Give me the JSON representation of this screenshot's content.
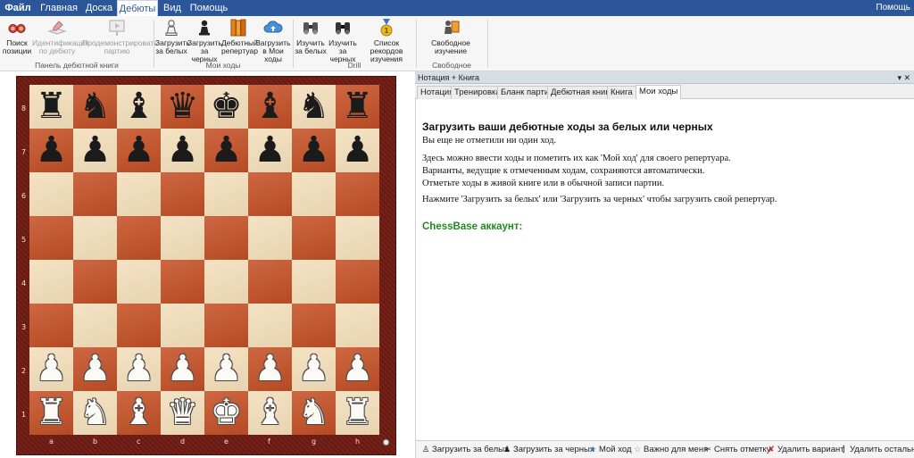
{
  "menu": {
    "tabs": [
      {
        "label": "Файл"
      },
      {
        "label": "Главная"
      },
      {
        "label": "Доска"
      },
      {
        "label": "Дебюты"
      },
      {
        "label": "Вид"
      },
      {
        "label": "Помощь"
      }
    ],
    "active": "Дебюты",
    "right_help": "Помощь"
  },
  "ribbon": {
    "buttons": [
      {
        "label": "Поиск позиции",
        "icon": "glasses-icon",
        "enabled": true
      },
      {
        "label": "Идентификация по дебюту",
        "icon": "book-pen-icon",
        "enabled": false
      },
      {
        "label": "Продемонстрировать партию",
        "icon": "presentation-icon",
        "enabled": false
      },
      {
        "label": "Загрузить за белых",
        "icon": "white-pawn-icon",
        "enabled": true
      },
      {
        "label": "Загрузить за черных",
        "icon": "black-pawn-icon",
        "enabled": true
      },
      {
        "label": "Дебютный репертуар",
        "icon": "books-icon",
        "enabled": true
      },
      {
        "label": "Загрузить в Мои ходы",
        "icon": "cloud-upload-icon",
        "enabled": true
      },
      {
        "label": "Изучить за белых",
        "icon": "binoculars-icon",
        "enabled": true
      },
      {
        "label": "Изучить за черных",
        "icon": "binoculars-icon",
        "enabled": true
      },
      {
        "label": "Список рекордов изучения",
        "icon": "medal-icon",
        "enabled": true
      },
      {
        "label": "Свободное изучение",
        "icon": "free-study-icon",
        "enabled": true
      }
    ],
    "groups": [
      {
        "label": "Панель дебютной книги"
      },
      {
        "label": "Мои ходы"
      },
      {
        "label": "Drill"
      },
      {
        "label": "Свободное изучение"
      }
    ]
  },
  "board": {
    "files": [
      "a",
      "b",
      "c",
      "d",
      "e",
      "f",
      "g",
      "h"
    ],
    "ranks": [
      "8",
      "7",
      "6",
      "5",
      "4",
      "3",
      "2",
      "1"
    ],
    "position": [
      "rnbqkbnr",
      "pppppppp",
      "........",
      "........",
      "........",
      "........",
      "PPPPPPPP",
      "RNBQKBNR"
    ],
    "colors": {
      "light": "#f1dcb7",
      "dark": "#c8562c",
      "frame": "#6e1a12"
    }
  },
  "pane": {
    "title": "Нотация + Книга",
    "controls": "▾ ✕",
    "tabs": [
      {
        "label": "Нотация"
      },
      {
        "label": "Тренировка"
      },
      {
        "label": "Бланк партии"
      },
      {
        "label": "Дебютная книга"
      },
      {
        "label": "Книга"
      },
      {
        "label": "Мои ходы"
      }
    ],
    "active_tab": "Мои ходы",
    "heading": "Загрузить ваши дебютные ходы за белых или черных",
    "paragraphs": [
      "Вы еще не отметили ни один ход.",
      "Здесь можно ввести ходы и пометить их как 'Мой ход' для своего репертуара.",
      "Варианты, ведущие к отмеченным ходам, сохраняются автоматически.",
      "Отметьте ходы в живой книге или в обычной записи партии.",
      "Нажмите 'Загрузить за белых' или 'Загрузить за черных' чтобы загрузить свой репертуар."
    ],
    "account_label": "ChessBase аккаунт:",
    "account_color": "#1e8b1e"
  },
  "bottombar": {
    "buttons": [
      {
        "label": "Загрузить за белых",
        "icon": "white-pawn-icon"
      },
      {
        "label": "Загрузить за черных",
        "icon": "black-pawn-icon"
      },
      {
        "label": "Мой ход",
        "icon": "star-icon"
      },
      {
        "label": "Важно для меня",
        "icon": "star-outline-icon"
      },
      {
        "label": "Снять отметку",
        "icon": "unmark-icon"
      },
      {
        "label": "Удалить вариант",
        "icon": "delete-icon"
      },
      {
        "label": "Удалить остальные",
        "icon": "bracket-icon"
      }
    ]
  },
  "colors": {
    "menubar": "#2b579a",
    "accent_green": "#1e8b1e"
  }
}
